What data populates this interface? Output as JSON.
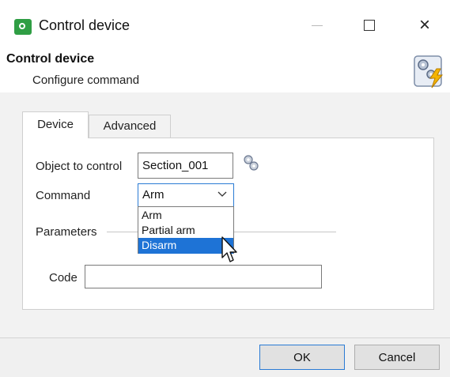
{
  "window": {
    "title": "Control device",
    "controls": {
      "minimize": "minimize",
      "maximize": "maximize",
      "close": "×"
    }
  },
  "header": {
    "title": "Control device",
    "subtitle": "Configure command",
    "icon": "gears-lightning-icon"
  },
  "tabs": [
    {
      "label": "Device",
      "active": true
    },
    {
      "label": "Advanced",
      "active": false
    }
  ],
  "form": {
    "object_label": "Object to control",
    "object_value": "Section_001",
    "command_label": "Command",
    "command_value": "Arm",
    "command_options": [
      "Arm",
      "Partial arm",
      "Disarm"
    ],
    "command_highlighted": "Disarm",
    "parameters_label": "Parameters",
    "code_label": "Code",
    "code_value": ""
  },
  "buttons": {
    "ok": "OK",
    "cancel": "Cancel"
  },
  "colors": {
    "accent": "#2a7bd4",
    "selection": "#1e73d6",
    "app_icon": "#2f9e44",
    "panel": "#f2f2f2"
  }
}
